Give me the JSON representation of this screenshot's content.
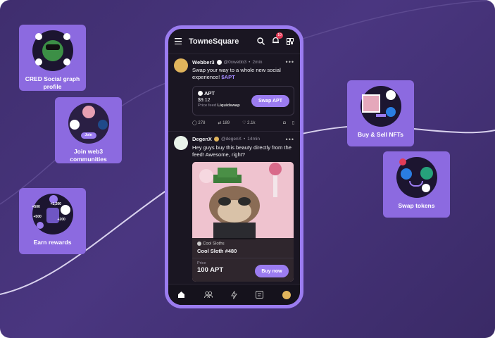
{
  "cards": {
    "cred": "CRED Social graph profile",
    "join": "Join web3 communities",
    "join_badge": "Join",
    "earn": "Earn rewards",
    "buy_sell": "Buy & Sell NFTs",
    "swap": "Swap tokens",
    "earn_amounts": [
      "+500",
      "+1,200",
      "+500",
      "+200"
    ]
  },
  "phone": {
    "app_title": "TowneSquare",
    "notification_count": "10",
    "post1": {
      "name": "Webber3",
      "handle": "@0xwebb3",
      "time": "2min",
      "text": "Swap your way to a whole new social experience!",
      "token_tag": "$APT",
      "token_symbol": "APT",
      "token_price": "$9.12",
      "feed_prefix": "Price feed",
      "feed_source": "Liquidswap",
      "swap_label": "Swap APT",
      "comments": "278",
      "reposts": "189",
      "likes": "2.1k"
    },
    "post2": {
      "name": "DegenX",
      "handle": "@degenX",
      "time": "14min",
      "text": "Hey guys buy this beauty directly from the feed! Awesome, right?",
      "collection": "Cool Sloths",
      "nft_name": "Cool Sloth #480",
      "price_label": "Price",
      "price": "100 APT",
      "buy_label": "Buy now"
    }
  },
  "colors": {
    "background": "#45327a",
    "card": "#8c6ae0",
    "accent": "#9b7cf0",
    "phone_bg": "#1a1622"
  }
}
